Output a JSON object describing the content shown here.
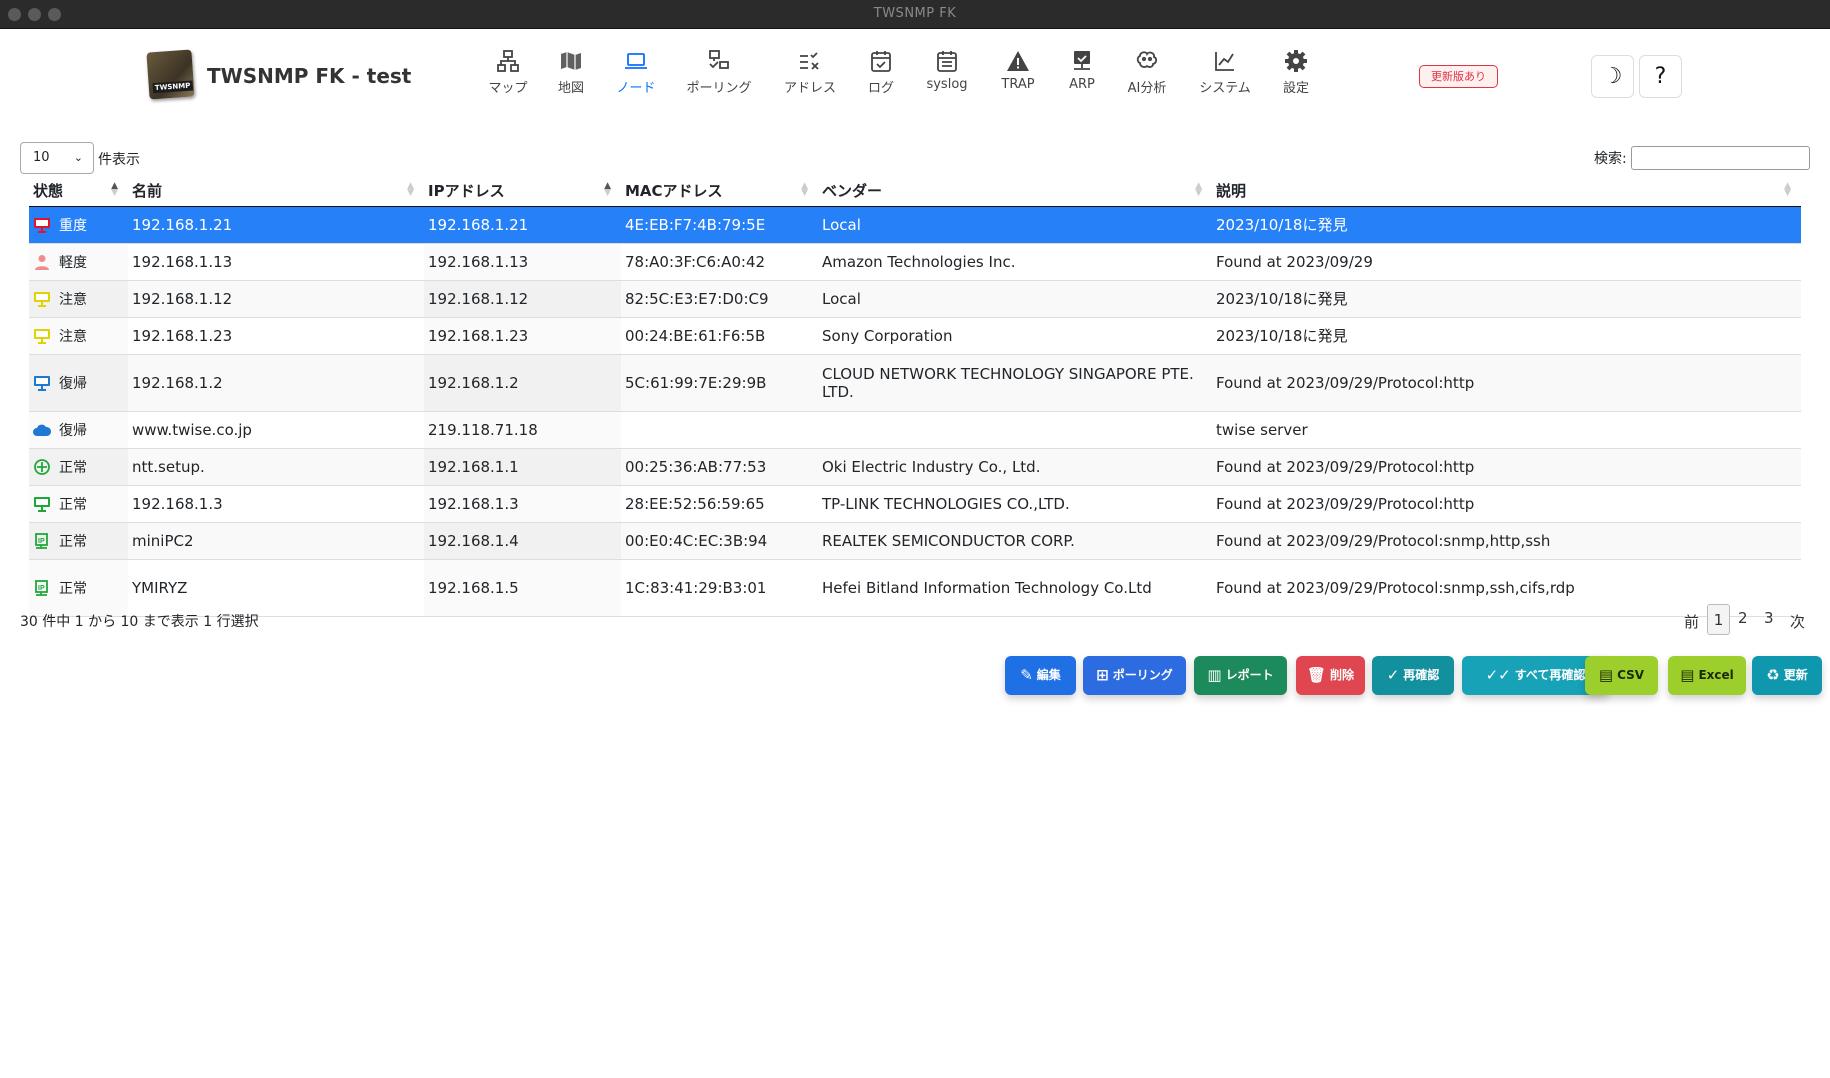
{
  "window": {
    "title": "TWSNMP FK"
  },
  "header": {
    "app_title": "TWSNMP FK - test",
    "logo_text": "TWSNMP",
    "nav": [
      {
        "label": "マップ",
        "icon": "network-map-icon"
      },
      {
        "label": "地図",
        "icon": "map-icon"
      },
      {
        "label": "ノード",
        "icon": "laptop-icon",
        "active": true
      },
      {
        "label": "ポーリング",
        "icon": "polling-icon"
      },
      {
        "label": "アドレス",
        "icon": "address-check-icon"
      },
      {
        "label": "ログ",
        "icon": "calendar-check-icon"
      },
      {
        "label": "syslog",
        "icon": "calendar-icon"
      },
      {
        "label": "TRAP",
        "icon": "warning-triangle-icon"
      },
      {
        "label": "ARP",
        "icon": "display-check-icon"
      },
      {
        "label": "AI分析",
        "icon": "brain-icon"
      },
      {
        "label": "システム",
        "icon": "line-chart-icon"
      },
      {
        "label": "設定",
        "icon": "gear-icon"
      }
    ],
    "update_badge": "更新版あり",
    "dark_mode_icon": "moon-icon",
    "help_label": "?"
  },
  "table_controls": {
    "page_length": "10",
    "page_length_suffix": "件表示",
    "search_label": "検索:",
    "search_value": ""
  },
  "columns": [
    "状態",
    "名前",
    "IPアドレス",
    "MACアドレス",
    "ベンダー",
    "説明"
  ],
  "rows": [
    {
      "state": "重度",
      "state_icon": "monitor-icon",
      "state_color": "#dc3545",
      "name": "192.168.1.21",
      "ip": "192.168.1.21",
      "mac": "4E:EB:F7:4B:79:5E",
      "vendor": "Local",
      "desc": "2023/10/18に発見",
      "selected": true
    },
    {
      "state": "軽度",
      "state_icon": "person-icon",
      "state_color": "#f28b8b",
      "name": "192.168.1.13",
      "ip": "192.168.1.13",
      "mac": "78:A0:3F:C6:A0:42",
      "vendor": "Amazon Technologies Inc.",
      "desc": "Found at 2023/09/29"
    },
    {
      "state": "注意",
      "state_icon": "monitor-icon",
      "state_color": "#e0d400",
      "name": "192.168.1.12",
      "ip": "192.168.1.12",
      "mac": "82:5C:E3:E7:D0:C9",
      "vendor": "Local",
      "desc": "2023/10/18に発見"
    },
    {
      "state": "注意",
      "state_icon": "monitor-icon",
      "state_color": "#e0d400",
      "name": "192.168.1.23",
      "ip": "192.168.1.23",
      "mac": "00:24:BE:61:F6:5B",
      "vendor": "Sony Corporation",
      "desc": "2023/10/18に発見"
    },
    {
      "state": "復帰",
      "state_icon": "monitor-icon",
      "state_color": "#1f78d1",
      "name": "192.168.1.2",
      "ip": "192.168.1.2",
      "mac": "5C:61:99:7E:29:9B",
      "vendor": "CLOUD NETWORK TECHNOLOGY SINGAPORE PTE. LTD.",
      "desc": "Found at 2023/09/29/Protocol:http"
    },
    {
      "state": "復帰",
      "state_icon": "cloud-icon",
      "state_color": "#1f78d1",
      "name": "www.twise.co.jp",
      "ip": "219.118.71.18",
      "mac": "",
      "vendor": "",
      "desc": "twise server"
    },
    {
      "state": "正常",
      "state_icon": "router-icon",
      "state_color": "#1fa83a",
      "name": "ntt.setup.",
      "ip": "192.168.1.1",
      "mac": "00:25:36:AB:77:53",
      "vendor": "Oki Electric Industry Co., Ltd.",
      "desc": "Found at 2023/09/29/Protocol:http"
    },
    {
      "state": "正常",
      "state_icon": "monitor-icon",
      "state_color": "#1fa83a",
      "name": "192.168.1.3",
      "ip": "192.168.1.3",
      "mac": "28:EE:52:56:59:65",
      "vendor": "TP-LINK TECHNOLOGIES CO.,LTD.",
      "desc": "Found at 2023/09/29/Protocol:http"
    },
    {
      "state": "正常",
      "state_icon": "ip-device-icon",
      "state_color": "#1fa83a",
      "name": "miniPC2",
      "ip": "192.168.1.4",
      "mac": "00:E0:4C:EC:3B:94",
      "vendor": "REALTEK SEMICONDUCTOR CORP.",
      "desc": "Found at 2023/09/29/Protocol:snmp,http,ssh"
    },
    {
      "state": "正常",
      "state_icon": "ip-device-icon",
      "state_color": "#1fa83a",
      "name": "YMIRYZ",
      "ip": "192.168.1.5",
      "mac": "1C:83:41:29:B3:01",
      "vendor": "Hefei Bitland Information Technology Co.Ltd",
      "desc": "Found at 2023/09/29/Protocol:snmp,ssh,cifs,rdp"
    }
  ],
  "footer": {
    "info": "30 件中 1 から 10 まで表示 1 行選択",
    "prev": "前",
    "pages": [
      "1",
      "2",
      "3"
    ],
    "current_page": "1",
    "next": "次"
  },
  "actions": [
    {
      "label": "編集",
      "icon": "pencil-icon",
      "color": "#1f6fe5"
    },
    {
      "label": "ポーリング",
      "icon": "polling-icon",
      "color": "#2d6be0"
    },
    {
      "label": "レポート",
      "icon": "bar-chart-icon",
      "color": "#1c8a5a"
    },
    {
      "label": "削除",
      "icon": "trash-icon",
      "color": "#e04650"
    },
    {
      "label": "再確認",
      "icon": "check-icon",
      "color": "#12909e"
    },
    {
      "label": "すべて再確認",
      "icon": "double-check-icon",
      "color": "#17a2b8"
    },
    {
      "label": "CSV",
      "icon": "file-csv-icon",
      "color": "#9ccf2b"
    },
    {
      "label": "Excel",
      "icon": "file-excel-icon",
      "color": "#9ccf2b"
    },
    {
      "label": "更新",
      "icon": "recycle-icon",
      "color": "#0f98ad"
    }
  ]
}
